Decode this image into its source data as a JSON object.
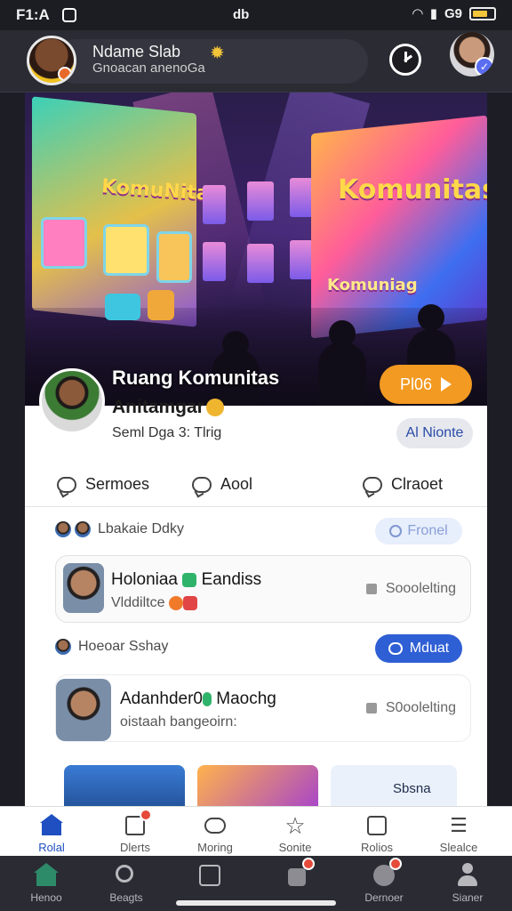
{
  "status_bar": {
    "time": "F1:A",
    "carrier": "db",
    "network": "G9"
  },
  "header": {
    "title": "Ndame Slab",
    "subtitle": "Gnoacan anenoGa",
    "clock_icon": "clock-icon"
  },
  "hero": {
    "screen_left_text": "KomuNitas",
    "screen_right_text": "Komunitas",
    "screen_right_text2": "Komuniag",
    "title_line1": "Ruang Komunitas",
    "title_line2": "Anitamgar",
    "subline": "Seml Dga 3: Tlrig",
    "play_label": "Pl06",
    "follow_label": "Al Nionte"
  },
  "tabs": [
    {
      "label": "Sermoes",
      "icon": "comment-icon"
    },
    {
      "label": "Aool",
      "icon": "comment-icon"
    },
    {
      "label": "Clraoet",
      "icon": "chat-icon"
    }
  ],
  "feed": {
    "row1": {
      "label": "Lbakaie Ddky",
      "button": "Fronel"
    },
    "card1": {
      "name": "Holoniaa",
      "name_suffix": "Eandiss",
      "sub": "Vlddiltce",
      "right": "Sooolelting"
    },
    "row2": {
      "label": "Hoeoar Sshay",
      "button": "Mduat"
    },
    "card2": {
      "name": "Adanhder0",
      "name_suffix": "Maochg",
      "sub": "oistaah bangeoirn:",
      "right": "S0oolelting"
    },
    "thumb3_label": "Sbsna"
  },
  "nav_top": [
    {
      "label": "Rolal",
      "icon": "home-icon",
      "active": true
    },
    {
      "label": "Dlerts",
      "icon": "alerts-icon",
      "badge": true
    },
    {
      "label": "Moring",
      "icon": "chat-bubble-icon"
    },
    {
      "label": "Sonite",
      "icon": "star-icon"
    },
    {
      "label": "Rolios",
      "icon": "news-icon"
    },
    {
      "label": "Slealce",
      "icon": "list-icon"
    }
  ],
  "nav_bottom": [
    {
      "label": "Henoo",
      "icon": "home-icon"
    },
    {
      "label": "Beagts",
      "icon": "search-icon"
    },
    {
      "label": "",
      "icon": "edit-icon"
    },
    {
      "label": "",
      "icon": "bag-icon",
      "badge": true
    },
    {
      "label": "Dernoer",
      "icon": "user-badge-icon",
      "badge": true
    },
    {
      "label": "Sianer",
      "icon": "person-icon"
    }
  ],
  "colors": {
    "accent_orange": "#f39a22",
    "accent_blue": "#2f5fd4",
    "home_active": "#1f4fc0"
  }
}
